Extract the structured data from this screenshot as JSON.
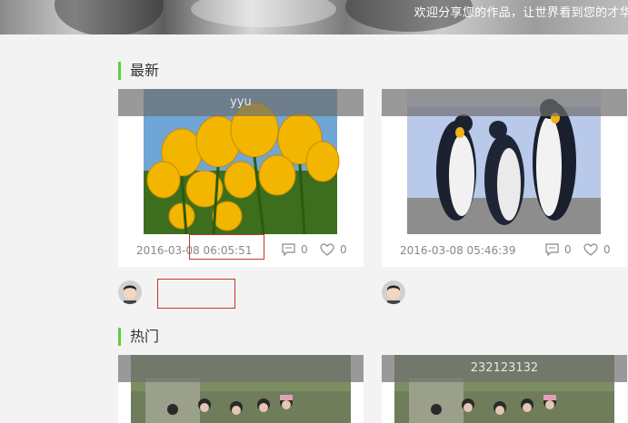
{
  "banner": {
    "text": "欢迎分享您的作品，让世界看到您的才华"
  },
  "sections": [
    {
      "title": "最新"
    },
    {
      "title": "热门"
    }
  ],
  "latest": [
    {
      "overlay": "yyu",
      "date": "2016-03-08 06:05:51",
      "comments": "0",
      "likes": "0",
      "image": "yellow-tulips"
    },
    {
      "overlay": "",
      "date": "2016-03-08 05:46:39",
      "comments": "0",
      "likes": "0",
      "image": "penguins"
    }
  ],
  "hot": [
    {
      "overlay": "",
      "image": "group-photo"
    },
    {
      "overlay": "232123132",
      "image": "group-photo"
    }
  ],
  "colors": {
    "accent": "#5cd03b",
    "highlight": "#c0392b"
  }
}
